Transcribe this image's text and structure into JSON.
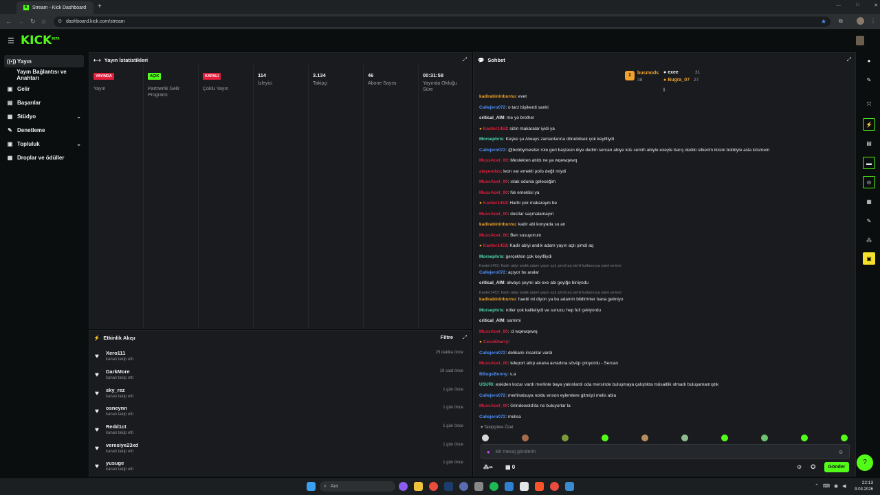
{
  "browser": {
    "tab_title": "Stream - Kick Dashboard",
    "new_tab": "+",
    "url": "dashboard.kick.com/stream",
    "window_controls": [
      "—",
      "□",
      "✕"
    ]
  },
  "app": {
    "logo": "KICK",
    "logo_sup": "BETA",
    "brand_color": "#53fc18"
  },
  "sidebar": {
    "items": [
      {
        "label": "Yayın",
        "icon": "broadcast-icon"
      },
      {
        "label": "Yayın Bağlantısı ve Anahtarı",
        "icon": "key-icon"
      },
      {
        "label": "Gelir",
        "icon": "money-icon"
      },
      {
        "label": "Başarılar",
        "icon": "trophy-icon"
      },
      {
        "label": "Stüdyo",
        "icon": "studio-icon"
      },
      {
        "label": "Denetleme",
        "icon": "wrench-icon"
      },
      {
        "label": "Topluluk",
        "icon": "community-icon"
      },
      {
        "label": "Droplar ve ödüller",
        "icon": "gift-icon"
      }
    ]
  },
  "stats": {
    "title": "Yayın İstatistikleri",
    "columns": [
      {
        "badge": "YAYINDA",
        "badge_color": "#e31e3c",
        "label": "Yayın"
      },
      {
        "badge": "AÇIK",
        "badge_color": "#53fc18",
        "label": "Partnerlik Gelir Programı"
      },
      {
        "badge": "KAPALI",
        "badge_color": "#e31e3c",
        "label": "Çoklu Yayın"
      },
      {
        "value": "114",
        "label": "İzleyici"
      },
      {
        "value": "3.134",
        "label": "Takipçi"
      },
      {
        "value": "46",
        "label": "Abone Sayısı"
      },
      {
        "value": "00:31:58",
        "label": "Yayında Olduğu Süre"
      }
    ]
  },
  "activity": {
    "title": "Etkinlik Akışı",
    "filter": "Filtre",
    "items": [
      {
        "user": "Xero111",
        "action": "kanalı takip etti",
        "time": "25 dakika önce"
      },
      {
        "user": "DarkMore",
        "action": "kanalı takip etti",
        "time": "19 saat önce"
      },
      {
        "user": "sky_rez",
        "action": "kanalı takip etti",
        "time": "1 gün önce"
      },
      {
        "user": "osneynn",
        "action": "kanalı takip etti",
        "time": "1 gün önce"
      },
      {
        "user": "Redd1ct",
        "action": "kanalı takip etti",
        "time": "1 gün önce"
      },
      {
        "user": "veresiye23xd",
        "action": "kanalı takip etti",
        "time": "1 gün önce"
      },
      {
        "user": "yusuge",
        "action": "kanalı takip etti",
        "time": "1 gün önce"
      }
    ]
  },
  "chat": {
    "title": "Sohbet",
    "leaderboard": [
      {
        "name": "busmods",
        "count": "38"
      },
      {
        "name": "exee",
        "count": "31"
      },
      {
        "name": "Bugra_07",
        "count": "27"
      }
    ],
    "messages": [
      {
        "user": "kadirabininburnu",
        "color": "#f0a22c",
        "text": "evet"
      },
      {
        "user": "Callejero072",
        "color": "#4f8ef7",
        "text": "o tarz bişikerdi sanki"
      },
      {
        "user": "critical_AIM",
        "color": "#e6e8ea",
        "text": "me yo brother"
      },
      {
        "user": "Kanter1453",
        "color": "#e31e3c",
        "text": "sizin makaralar iyidi ya"
      },
      {
        "user": "Morsephris",
        "color": "#4fd6b0",
        "text": "Keşke şu Always zamanlarına dönebilsek çok keyifliydi"
      },
      {
        "user": "Callejero072",
        "color": "#4f8ef7",
        "text": "@bobbymesiter role geri başlasın diye dedim sercan abiye küs semih abiyle exeyle barış dediki silkerim ikisini bobbyle asla küsmem"
      },
      {
        "user": "MussAcet_00",
        "color": "#e31e3c",
        "text": "Meslekten atıldı ne ya wqewqewq"
      },
      {
        "user": "alayendas",
        "color": "#e31e3c",
        "text": "leon var emekli polis değil miydi"
      },
      {
        "user": "MussAcet_00",
        "color": "#e31e3c",
        "text": "ıslak odunla geleceğim"
      },
      {
        "user": "MussAcet_00",
        "color": "#e31e3c",
        "text": "Ne emeklisi ya"
      },
      {
        "user": "Kanter1453",
        "color": "#e31e3c",
        "text": "Harbi çok makaraydı be"
      },
      {
        "user": "MussAcet_00",
        "color": "#e31e3c",
        "text": "dostlar saçmalamayın"
      },
      {
        "user": "kadirabininburnu",
        "color": "#f0a22c",
        "text": "kadir abi konyada su an"
      },
      {
        "user": "MussAcet_00",
        "color": "#e31e3c",
        "text": "Ben susuyorum"
      },
      {
        "user": "Kanter1453",
        "color": "#e31e3c",
        "text": "Kadir abiyi andık adam yayın açtı şimdi aq"
      },
      {
        "user": "Morsephris",
        "color": "#4fd6b0",
        "text": "gerçekten çok keyifliydi"
      },
      {
        "user": "Callejero072",
        "color": "#4f8ef7",
        "text": "açıyor bu aralar"
      },
      {
        "user": "critical_AIM",
        "color": "#e6e8ea",
        "text": "always şeymi abi exe abi geyiğe biniyodu"
      },
      {
        "user": "kadirabininburnu",
        "color": "#f0a22c",
        "text": "haebi mi diyon ya bu adamin bildirimler bana gelmiyo"
      },
      {
        "user": "Morsephris",
        "color": "#4fd6b0",
        "text": "roller çok kaliteliydi ve sunucu hep full çekiyordu"
      },
      {
        "user": "critical_AIM",
        "color": "#e6e8ea",
        "text": "samimi"
      },
      {
        "user": "MussAcet_00",
        "color": "#e31e3c",
        "text": ":d wqewqewq"
      },
      {
        "user": "CecoSharry",
        "color": "#e31e3c",
        "text": ""
      },
      {
        "user": "Callejero072",
        "color": "#4f8ef7",
        "text": "delikanlı insanlar vardı"
      },
      {
        "user": "MussAcet_00",
        "color": "#e31e3c",
        "text": "teleport attıp anana avradına sövüp çıkıyordu - Sercan"
      },
      {
        "user": "BBugsBunny",
        "color": "#4f8ef7",
        "text": "s.a"
      },
      {
        "user": "USURi",
        "color": "#4fd6b0",
        "text": "eskiden kozar vardı merlinle baya yakınlardı oda mersinde buluşmaya çalıştıkta müsaitlik olmadı buluşamamıştık"
      },
      {
        "user": "Callejero072",
        "color": "#4f8ef7",
        "text": "merlinatsuya noldu enson eylemlere gitmişti melis abla"
      },
      {
        "user": "MussAcet_00",
        "color": "#e31e3c",
        "text": "Grindewold'da ne buluyorlar la"
      },
      {
        "user": "Callejero072",
        "color": "#4f8ef7",
        "text": "melisa"
      }
    ],
    "replies": [
      "Kanter1453: Kadir abiyi andık adam yayın açtı şimdi aq isimli kullanıcıya yanıt veriyor",
      "Kanter1453: Kadir abiyi andık adam yayın açtı şimdi aq isimli kullanıcıya yanıt veriyor"
    ],
    "followers_only": "Takipçilere Özel",
    "input_placeholder": "Bir mesaj gönderin",
    "points_label": "∞",
    "count_label": "0",
    "send_label": "Gönder"
  },
  "taskbar": {
    "search_placeholder": "Ara",
    "time": "22:13",
    "date": "9.03.2026"
  }
}
